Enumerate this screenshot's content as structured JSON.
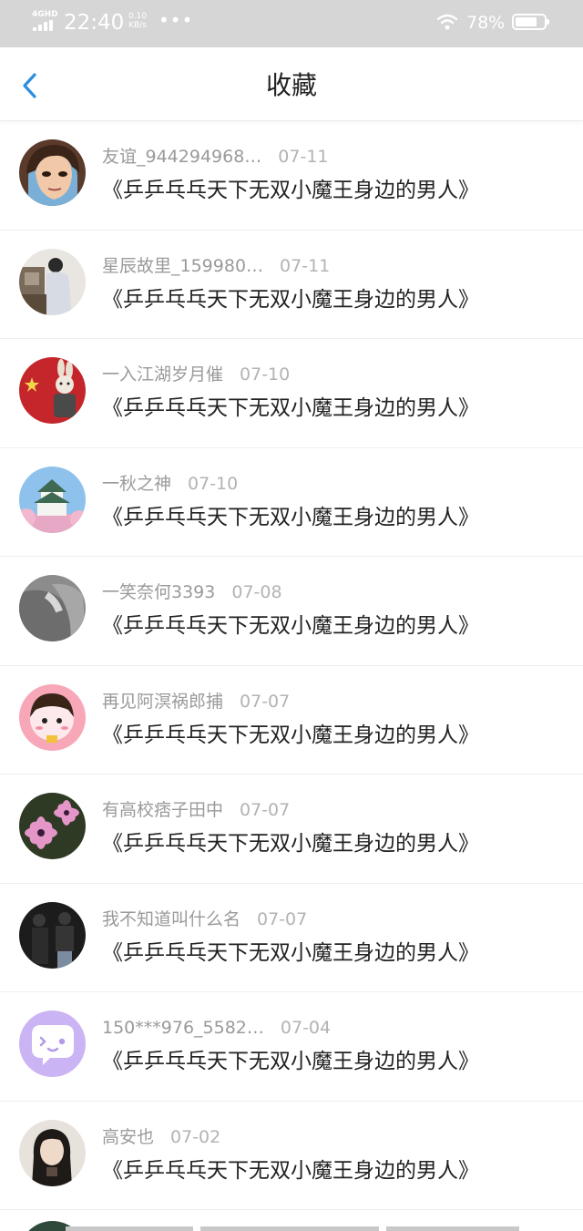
{
  "status_bar": {
    "network": "4GHD",
    "time": "22:40",
    "speed_value": "0.10",
    "speed_unit": "KB/s",
    "battery": "78%",
    "battery_level": 0.78
  },
  "header": {
    "back_icon": "chevron-left-icon",
    "title": "收藏",
    "accent": "#2a8fe0"
  },
  "items": [
    {
      "user": "友谊_944294968…",
      "date": "07-11",
      "title": "《乒乒乓乓天下无双小魔王身边的男人》"
    },
    {
      "user": "星辰故里_159980…",
      "date": "07-11",
      "title": "《乒乒乓乓天下无双小魔王身边的男人》"
    },
    {
      "user": "一入江湖岁月催",
      "date": "07-10",
      "title": "《乒乒乓乓天下无双小魔王身边的男人》"
    },
    {
      "user": "一秋之神",
      "date": "07-10",
      "title": "《乒乒乓乓天下无双小魔王身边的男人》"
    },
    {
      "user": "一笑奈何3393",
      "date": "07-08",
      "title": "《乒乒乓乓天下无双小魔王身边的男人》"
    },
    {
      "user": "再见阿溟祸郎捕",
      "date": "07-07",
      "title": "《乒乒乓乓天下无双小魔王身边的男人》"
    },
    {
      "user": "有高校痞子田中",
      "date": "07-07",
      "title": "《乒乒乓乓天下无双小魔王身边的男人》"
    },
    {
      "user": "我不知道叫什么名",
      "date": "07-07",
      "title": "《乒乒乓乓天下无双小魔王身边的男人》"
    },
    {
      "user": "150***976_5582…",
      "date": "07-04",
      "title": "《乒乒乓乓天下无双小魔王身边的男人》"
    },
    {
      "user": "高安也",
      "date": "07-02",
      "title": "《乒乒乓乓天下无双小魔王身边的男人》"
    }
  ]
}
